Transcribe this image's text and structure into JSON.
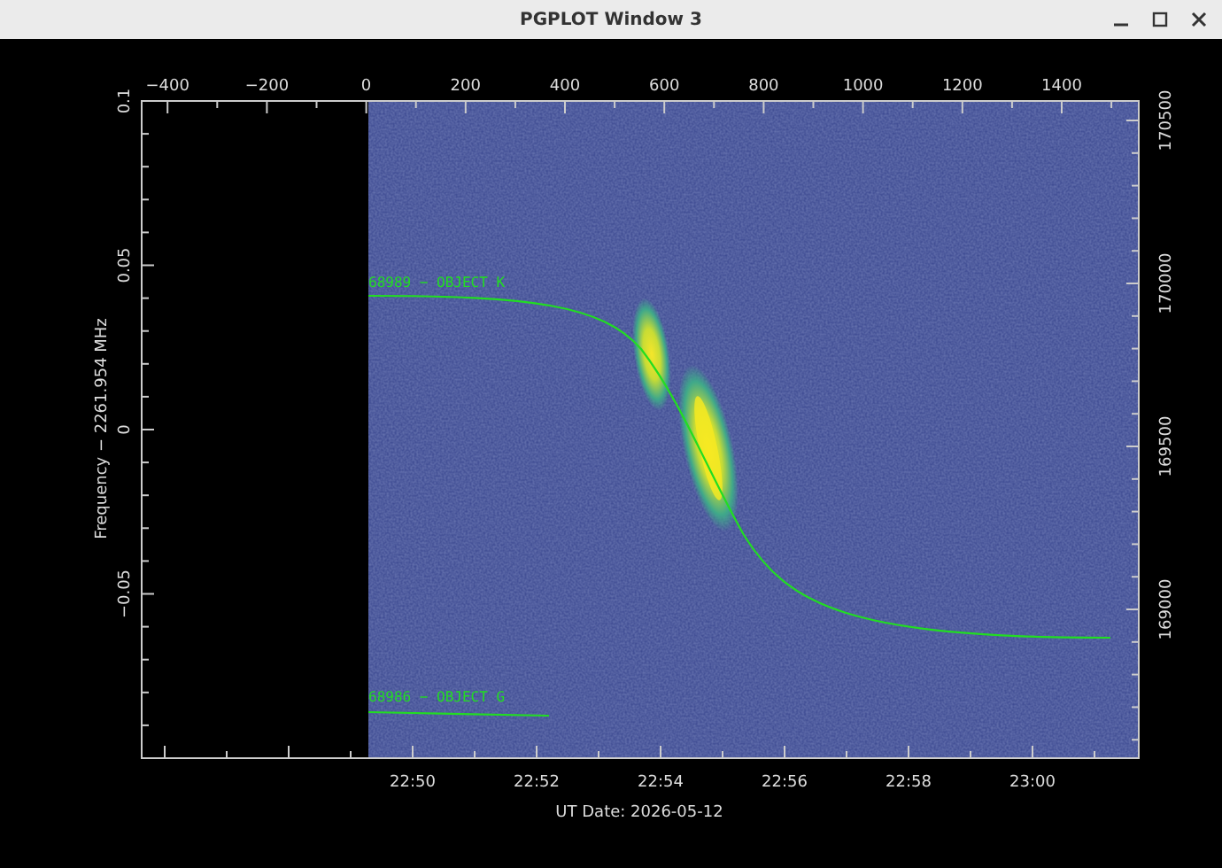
{
  "window": {
    "title": "PGPLOT Window 3"
  },
  "plot": {
    "top_axis": {
      "ticks": [
        "−400",
        "−200",
        "0",
        "200",
        "400",
        "600",
        "800",
        "1000",
        "1200",
        "1400"
      ]
    },
    "left_axis": {
      "title": "Frequency − 2261.954 MHz",
      "ticks": [
        "0.1",
        "0.05",
        "0",
        "−0.05"
      ]
    },
    "right_axis": {
      "ticks": [
        "170500",
        "170000",
        "169500",
        "169000"
      ]
    },
    "bottom_axis": {
      "title": "UT Date: 2026-05-12",
      "ticks": [
        "22:50",
        "22:52",
        "22:54",
        "22:56",
        "22:58",
        "23:00"
      ]
    },
    "tracks": [
      {
        "label": "68989 − OBJECT K"
      },
      {
        "label": "68986 − OBJECT G"
      }
    ]
  }
}
